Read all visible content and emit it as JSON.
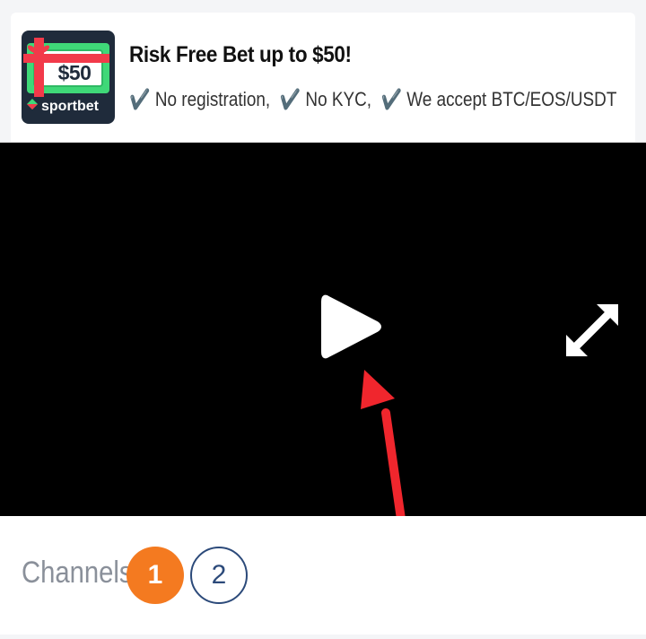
{
  "ad": {
    "logo": {
      "amount": "$50",
      "brand": "sportbet"
    },
    "title": "Risk Free Bet up to $50!",
    "features": [
      {
        "check": "✔️",
        "text": "No registration,"
      },
      {
        "check": "✔️",
        "text": "No KYC,"
      },
      {
        "check": "✔️",
        "text": "We accept BTC/EOS/USDT"
      }
    ]
  },
  "player": {
    "play_icon": "play-icon",
    "fullscreen_icon": "expand-icon"
  },
  "annotation": {
    "color": "#f0262d"
  },
  "channels": {
    "label": "Channels",
    "items": [
      {
        "label": "1",
        "active": true,
        "color": "#f47a20"
      },
      {
        "label": "2",
        "active": false,
        "color": "#2c4a7a"
      }
    ]
  }
}
